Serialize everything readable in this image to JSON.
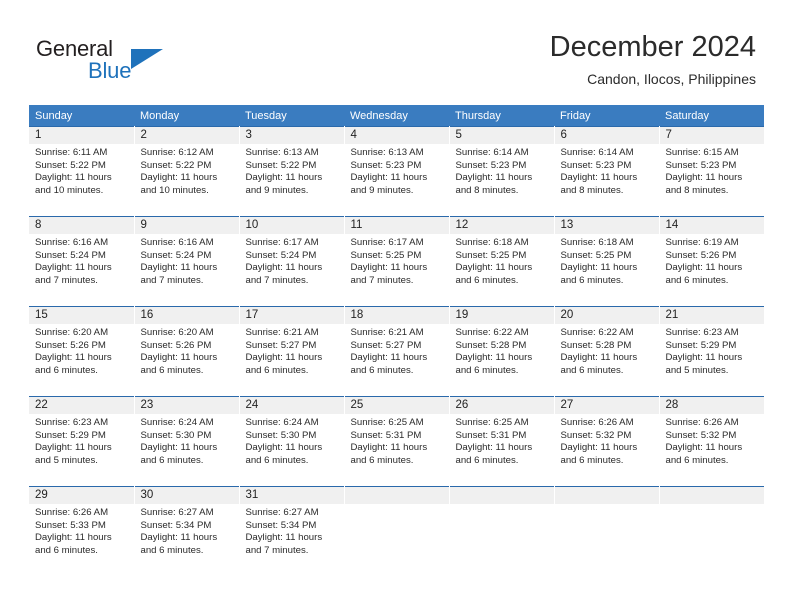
{
  "brand": {
    "word1": "General",
    "word2": "Blue",
    "logo_icon": "blue-triangle-logo",
    "colors": {
      "text": "#231f20",
      "accent": "#1f72bb"
    }
  },
  "header": {
    "title": "December 2024",
    "subtitle": "Candon, Ilocos, Philippines"
  },
  "colors": {
    "header_band": "#3a7cc0",
    "row_divider": "#2a69ab",
    "daynum_band": "#f0f0f0"
  },
  "labels": {
    "sunrise_prefix": "Sunrise:",
    "sunset_prefix": "Sunset:",
    "daylight_prefix": "Daylight:"
  },
  "weekdays": [
    "Sunday",
    "Monday",
    "Tuesday",
    "Wednesday",
    "Thursday",
    "Friday",
    "Saturday"
  ],
  "weeks": [
    [
      {
        "day": "1",
        "sunrise": "Sunrise: 6:11 AM",
        "sunset": "Sunset: 5:22 PM",
        "daylight_1": "Daylight: 11 hours",
        "daylight_2": "and 10 minutes."
      },
      {
        "day": "2",
        "sunrise": "Sunrise: 6:12 AM",
        "sunset": "Sunset: 5:22 PM",
        "daylight_1": "Daylight: 11 hours",
        "daylight_2": "and 10 minutes."
      },
      {
        "day": "3",
        "sunrise": "Sunrise: 6:13 AM",
        "sunset": "Sunset: 5:22 PM",
        "daylight_1": "Daylight: 11 hours",
        "daylight_2": "and 9 minutes."
      },
      {
        "day": "4",
        "sunrise": "Sunrise: 6:13 AM",
        "sunset": "Sunset: 5:23 PM",
        "daylight_1": "Daylight: 11 hours",
        "daylight_2": "and 9 minutes."
      },
      {
        "day": "5",
        "sunrise": "Sunrise: 6:14 AM",
        "sunset": "Sunset: 5:23 PM",
        "daylight_1": "Daylight: 11 hours",
        "daylight_2": "and 8 minutes."
      },
      {
        "day": "6",
        "sunrise": "Sunrise: 6:14 AM",
        "sunset": "Sunset: 5:23 PM",
        "daylight_1": "Daylight: 11 hours",
        "daylight_2": "and 8 minutes."
      },
      {
        "day": "7",
        "sunrise": "Sunrise: 6:15 AM",
        "sunset": "Sunset: 5:23 PM",
        "daylight_1": "Daylight: 11 hours",
        "daylight_2": "and 8 minutes."
      }
    ],
    [
      {
        "day": "8",
        "sunrise": "Sunrise: 6:16 AM",
        "sunset": "Sunset: 5:24 PM",
        "daylight_1": "Daylight: 11 hours",
        "daylight_2": "and 7 minutes."
      },
      {
        "day": "9",
        "sunrise": "Sunrise: 6:16 AM",
        "sunset": "Sunset: 5:24 PM",
        "daylight_1": "Daylight: 11 hours",
        "daylight_2": "and 7 minutes."
      },
      {
        "day": "10",
        "sunrise": "Sunrise: 6:17 AM",
        "sunset": "Sunset: 5:24 PM",
        "daylight_1": "Daylight: 11 hours",
        "daylight_2": "and 7 minutes."
      },
      {
        "day": "11",
        "sunrise": "Sunrise: 6:17 AM",
        "sunset": "Sunset: 5:25 PM",
        "daylight_1": "Daylight: 11 hours",
        "daylight_2": "and 7 minutes."
      },
      {
        "day": "12",
        "sunrise": "Sunrise: 6:18 AM",
        "sunset": "Sunset: 5:25 PM",
        "daylight_1": "Daylight: 11 hours",
        "daylight_2": "and 6 minutes."
      },
      {
        "day": "13",
        "sunrise": "Sunrise: 6:18 AM",
        "sunset": "Sunset: 5:25 PM",
        "daylight_1": "Daylight: 11 hours",
        "daylight_2": "and 6 minutes."
      },
      {
        "day": "14",
        "sunrise": "Sunrise: 6:19 AM",
        "sunset": "Sunset: 5:26 PM",
        "daylight_1": "Daylight: 11 hours",
        "daylight_2": "and 6 minutes."
      }
    ],
    [
      {
        "day": "15",
        "sunrise": "Sunrise: 6:20 AM",
        "sunset": "Sunset: 5:26 PM",
        "daylight_1": "Daylight: 11 hours",
        "daylight_2": "and 6 minutes."
      },
      {
        "day": "16",
        "sunrise": "Sunrise: 6:20 AM",
        "sunset": "Sunset: 5:26 PM",
        "daylight_1": "Daylight: 11 hours",
        "daylight_2": "and 6 minutes."
      },
      {
        "day": "17",
        "sunrise": "Sunrise: 6:21 AM",
        "sunset": "Sunset: 5:27 PM",
        "daylight_1": "Daylight: 11 hours",
        "daylight_2": "and 6 minutes."
      },
      {
        "day": "18",
        "sunrise": "Sunrise: 6:21 AM",
        "sunset": "Sunset: 5:27 PM",
        "daylight_1": "Daylight: 11 hours",
        "daylight_2": "and 6 minutes."
      },
      {
        "day": "19",
        "sunrise": "Sunrise: 6:22 AM",
        "sunset": "Sunset: 5:28 PM",
        "daylight_1": "Daylight: 11 hours",
        "daylight_2": "and 6 minutes."
      },
      {
        "day": "20",
        "sunrise": "Sunrise: 6:22 AM",
        "sunset": "Sunset: 5:28 PM",
        "daylight_1": "Daylight: 11 hours",
        "daylight_2": "and 6 minutes."
      },
      {
        "day": "21",
        "sunrise": "Sunrise: 6:23 AM",
        "sunset": "Sunset: 5:29 PM",
        "daylight_1": "Daylight: 11 hours",
        "daylight_2": "and 5 minutes."
      }
    ],
    [
      {
        "day": "22",
        "sunrise": "Sunrise: 6:23 AM",
        "sunset": "Sunset: 5:29 PM",
        "daylight_1": "Daylight: 11 hours",
        "daylight_2": "and 5 minutes."
      },
      {
        "day": "23",
        "sunrise": "Sunrise: 6:24 AM",
        "sunset": "Sunset: 5:30 PM",
        "daylight_1": "Daylight: 11 hours",
        "daylight_2": "and 6 minutes."
      },
      {
        "day": "24",
        "sunrise": "Sunrise: 6:24 AM",
        "sunset": "Sunset: 5:30 PM",
        "daylight_1": "Daylight: 11 hours",
        "daylight_2": "and 6 minutes."
      },
      {
        "day": "25",
        "sunrise": "Sunrise: 6:25 AM",
        "sunset": "Sunset: 5:31 PM",
        "daylight_1": "Daylight: 11 hours",
        "daylight_2": "and 6 minutes."
      },
      {
        "day": "26",
        "sunrise": "Sunrise: 6:25 AM",
        "sunset": "Sunset: 5:31 PM",
        "daylight_1": "Daylight: 11 hours",
        "daylight_2": "and 6 minutes."
      },
      {
        "day": "27",
        "sunrise": "Sunrise: 6:26 AM",
        "sunset": "Sunset: 5:32 PM",
        "daylight_1": "Daylight: 11 hours",
        "daylight_2": "and 6 minutes."
      },
      {
        "day": "28",
        "sunrise": "Sunrise: 6:26 AM",
        "sunset": "Sunset: 5:32 PM",
        "daylight_1": "Daylight: 11 hours",
        "daylight_2": "and 6 minutes."
      }
    ],
    [
      {
        "day": "29",
        "sunrise": "Sunrise: 6:26 AM",
        "sunset": "Sunset: 5:33 PM",
        "daylight_1": "Daylight: 11 hours",
        "daylight_2": "and 6 minutes."
      },
      {
        "day": "30",
        "sunrise": "Sunrise: 6:27 AM",
        "sunset": "Sunset: 5:34 PM",
        "daylight_1": "Daylight: 11 hours",
        "daylight_2": "and 6 minutes."
      },
      {
        "day": "31",
        "sunrise": "Sunrise: 6:27 AM",
        "sunset": "Sunset: 5:34 PM",
        "daylight_1": "Daylight: 11 hours",
        "daylight_2": "and 7 minutes."
      },
      {
        "day": "",
        "sunrise": "",
        "sunset": "",
        "daylight_1": "",
        "daylight_2": ""
      },
      {
        "day": "",
        "sunrise": "",
        "sunset": "",
        "daylight_1": "",
        "daylight_2": ""
      },
      {
        "day": "",
        "sunrise": "",
        "sunset": "",
        "daylight_1": "",
        "daylight_2": ""
      },
      {
        "day": "",
        "sunrise": "",
        "sunset": "",
        "daylight_1": "",
        "daylight_2": ""
      }
    ]
  ]
}
